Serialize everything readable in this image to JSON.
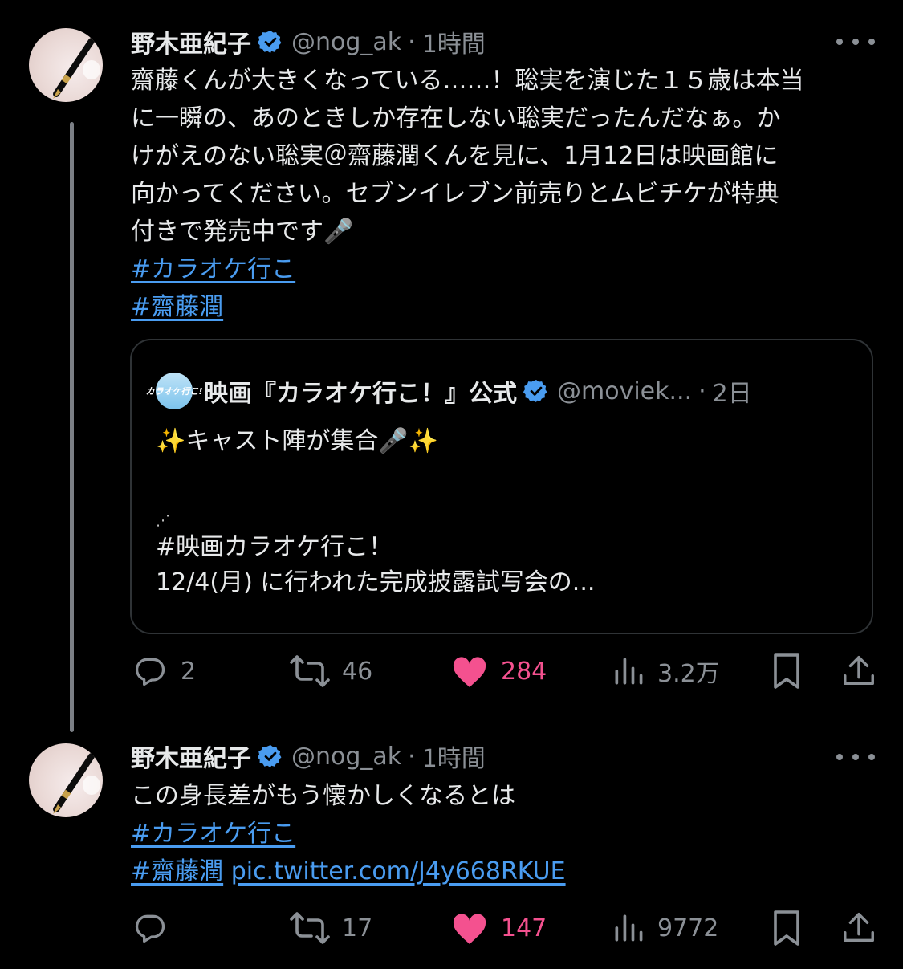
{
  "tweets": [
    {
      "author": "野木亜紀子",
      "handle": "@nog_ak",
      "time": "1時間",
      "lines": [
        "齋藤くんが大きくなっている……！聡実を演じた１５歳は本当",
        "に一瞬の、あのときしか存在しない聡実だったんだなぁ。か",
        "けがえのない聡実＠齋藤潤くんを見に、1月12日は映画館に",
        "向かってください。セブンイレブン前売りとムビチケが特典",
        "付きで発売中です🎤"
      ],
      "hashtags": [
        "#カラオケ行こ",
        "#齋藤潤"
      ],
      "quote": {
        "author": "映画『カラオケ行こ！』公式",
        "handle": "@moviek...",
        "time": "2日",
        "avatar_text": "カラオケ行こ!",
        "line1": "✨キャスト陣が集合🎤✨",
        "line2": "⋰",
        "line3": "#映画カラオケ行こ！",
        "line4": "12/4(月) に行われた完成披露試写会の..."
      },
      "stats": {
        "replies": "2",
        "retweets": "46",
        "likes": "284",
        "views": "3.2万"
      }
    },
    {
      "author": "野木亜紀子",
      "handle": "@nog_ak",
      "time": "1時間",
      "line1": "この身長差がもう懐かしくなるとは",
      "hashtag1": "#カラオケ行こ",
      "hashtag2": "#齋藤潤",
      "link": "pic.twitter.com/J4y668RKUE",
      "stats": {
        "replies": "",
        "retweets": "17",
        "likes": "147",
        "views": "9772"
      }
    }
  ],
  "colors": {
    "background": "#000000",
    "text": "#e7e9ea",
    "muted": "#8b9096",
    "link": "#4a9cf0",
    "like": "#f4518f",
    "verified": "#4a9cf0"
  },
  "icons": [
    "reply-icon",
    "retweet-icon",
    "like-icon",
    "views-icon",
    "bookmark-icon",
    "share-icon",
    "verified-badge-icon",
    "more-icon"
  ]
}
